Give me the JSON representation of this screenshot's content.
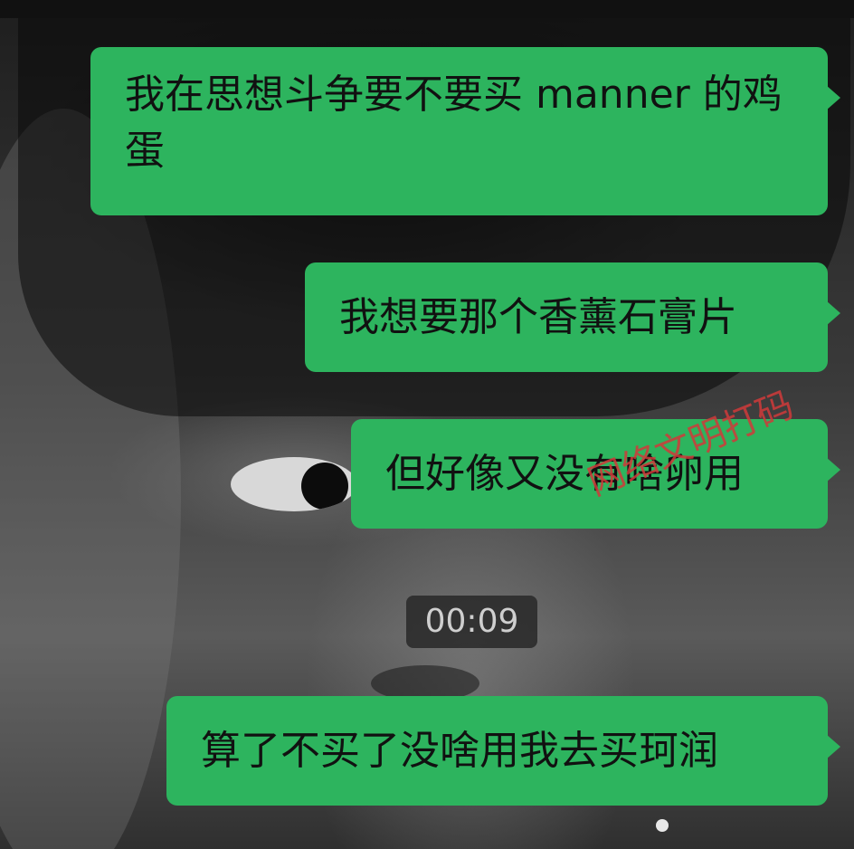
{
  "messages": [
    {
      "text": "我在思想斗争要不要买 manner 的鸡蛋"
    },
    {
      "text": "我想要那个香薰石膏片"
    },
    {
      "text": "但好像又没有啥卵用"
    },
    {
      "text": "算了不买了没啥用我去买珂润"
    }
  ],
  "timestamp": "00:09",
  "watermark": "网络文明打码",
  "colors": {
    "bubble": "#2db45e",
    "text": "#111111",
    "timestamp_bg": "#282828",
    "watermark": "#d03a3a"
  }
}
